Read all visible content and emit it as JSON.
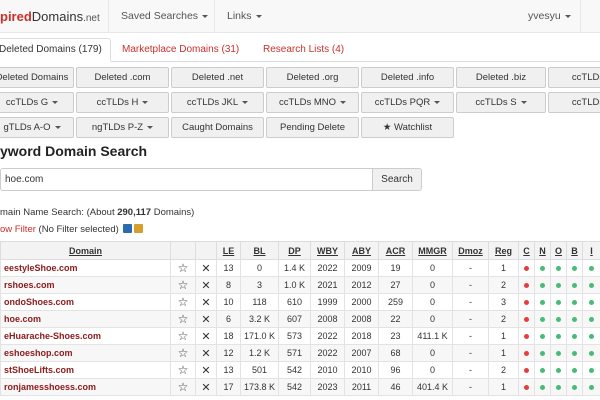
{
  "navbar": {
    "brand_accent": "pired",
    "brand_rest": "Domains",
    "brand_tld": ".net",
    "saved_searches": "Saved Searches",
    "links": "Links",
    "user": "yvesyu"
  },
  "tabs": [
    {
      "label": "Deleted Domains (179)"
    },
    {
      "label": "Marketplace Domains (31)"
    },
    {
      "label": "Research Lists (4)"
    }
  ],
  "filters": {
    "row1": [
      "Deleted Domains",
      "Deleted .com",
      "Deleted .net",
      "Deleted .org",
      "Deleted .info",
      "Deleted .biz",
      "ccTLDs"
    ],
    "row2": [
      "ccTLDs G",
      "ccTLDs H",
      "ccTLDs JKL",
      "ccTLDs MNO",
      "ccTLDs PQR",
      "ccTLDs S",
      "ccTLDs"
    ],
    "row3": [
      "gTLDs A-O",
      "ngTLDs P-Z",
      "Caught Domains",
      "Pending Delete",
      "★ Watchlist"
    ]
  },
  "search": {
    "title": "yword Domain Search",
    "value": "hoe.com",
    "button": "Search",
    "summary_prefix": "main Name Search: (About ",
    "summary_count": "290,117",
    "summary_suffix": " Domains)",
    "filter_link": "ow Filter",
    "filter_status": " (No Filter selected)"
  },
  "table": {
    "headers": [
      "",
      "",
      "",
      "Domain",
      "",
      "",
      "LE",
      "BL",
      "DP",
      "WBY",
      "ABY",
      "ACR",
      "MMGR",
      "Dmoz",
      "Reg",
      "C",
      "N",
      "O",
      "B",
      "I"
    ],
    "rows": [
      {
        "domain": "eestyleShoe.com",
        "le": "13",
        "bl": "0",
        "dp": "1.4 K",
        "wby": "2022",
        "aby": "2009",
        "acr": "19",
        "mmgr": "0",
        "dmoz": "-",
        "reg": "1",
        "dots": [
          "red",
          "green",
          "green",
          "green",
          "green"
        ]
      },
      {
        "domain": "rshoes.com",
        "le": "8",
        "bl": "3",
        "dp": "1.0 K",
        "wby": "2021",
        "aby": "2012",
        "acr": "27",
        "mmgr": "0",
        "dmoz": "-",
        "reg": "2",
        "dots": [
          "red",
          "green",
          "green",
          "green",
          "green"
        ]
      },
      {
        "domain": "ondoShoes.com",
        "le": "10",
        "bl": "118",
        "dp": "610",
        "wby": "1999",
        "aby": "2000",
        "acr": "259",
        "mmgr": "0",
        "dmoz": "-",
        "reg": "3",
        "dots": [
          "red",
          "green",
          "green",
          "green",
          "green"
        ]
      },
      {
        "domain": "hoe.com",
        "le": "6",
        "bl": "3.2 K",
        "dp": "607",
        "wby": "2008",
        "aby": "2008",
        "acr": "22",
        "mmgr": "0",
        "dmoz": "-",
        "reg": "2",
        "dots": [
          "red",
          "green",
          "green",
          "green",
          "green"
        ]
      },
      {
        "domain": "eHuarache-Shoes.com",
        "le": "18",
        "bl": "171.0 K",
        "dp": "573",
        "wby": "2022",
        "aby": "2018",
        "acr": "23",
        "mmgr": "411.1 K",
        "dmoz": "-",
        "reg": "1",
        "dots": [
          "red",
          "green",
          "green",
          "green",
          "green"
        ]
      },
      {
        "domain": "eshoeshop.com",
        "le": "12",
        "bl": "1.2 K",
        "dp": "571",
        "wby": "2022",
        "aby": "2007",
        "acr": "68",
        "mmgr": "0",
        "dmoz": "-",
        "reg": "1",
        "dots": [
          "red",
          "green",
          "green",
          "green",
          "green"
        ]
      },
      {
        "domain": "stShoeLifts.com",
        "le": "13",
        "bl": "501",
        "dp": "542",
        "wby": "2010",
        "aby": "2010",
        "acr": "96",
        "mmgr": "0",
        "dmoz": "-",
        "reg": "2",
        "dots": [
          "red",
          "green",
          "green",
          "green",
          "green"
        ]
      },
      {
        "domain": "ronjamesshoess.com",
        "le": "17",
        "bl": "173.8 K",
        "dp": "542",
        "wby": "2023",
        "aby": "2011",
        "acr": "46",
        "mmgr": "401.4 K",
        "dmoz": "-",
        "reg": "1",
        "dots": [
          "red",
          "green",
          "green",
          "green",
          "green"
        ]
      }
    ]
  },
  "colors": {
    "accent": "#c9302c",
    "domain": "#8b1a1a",
    "dot_red": "#e53e3e",
    "dot_green": "#48bb78"
  }
}
